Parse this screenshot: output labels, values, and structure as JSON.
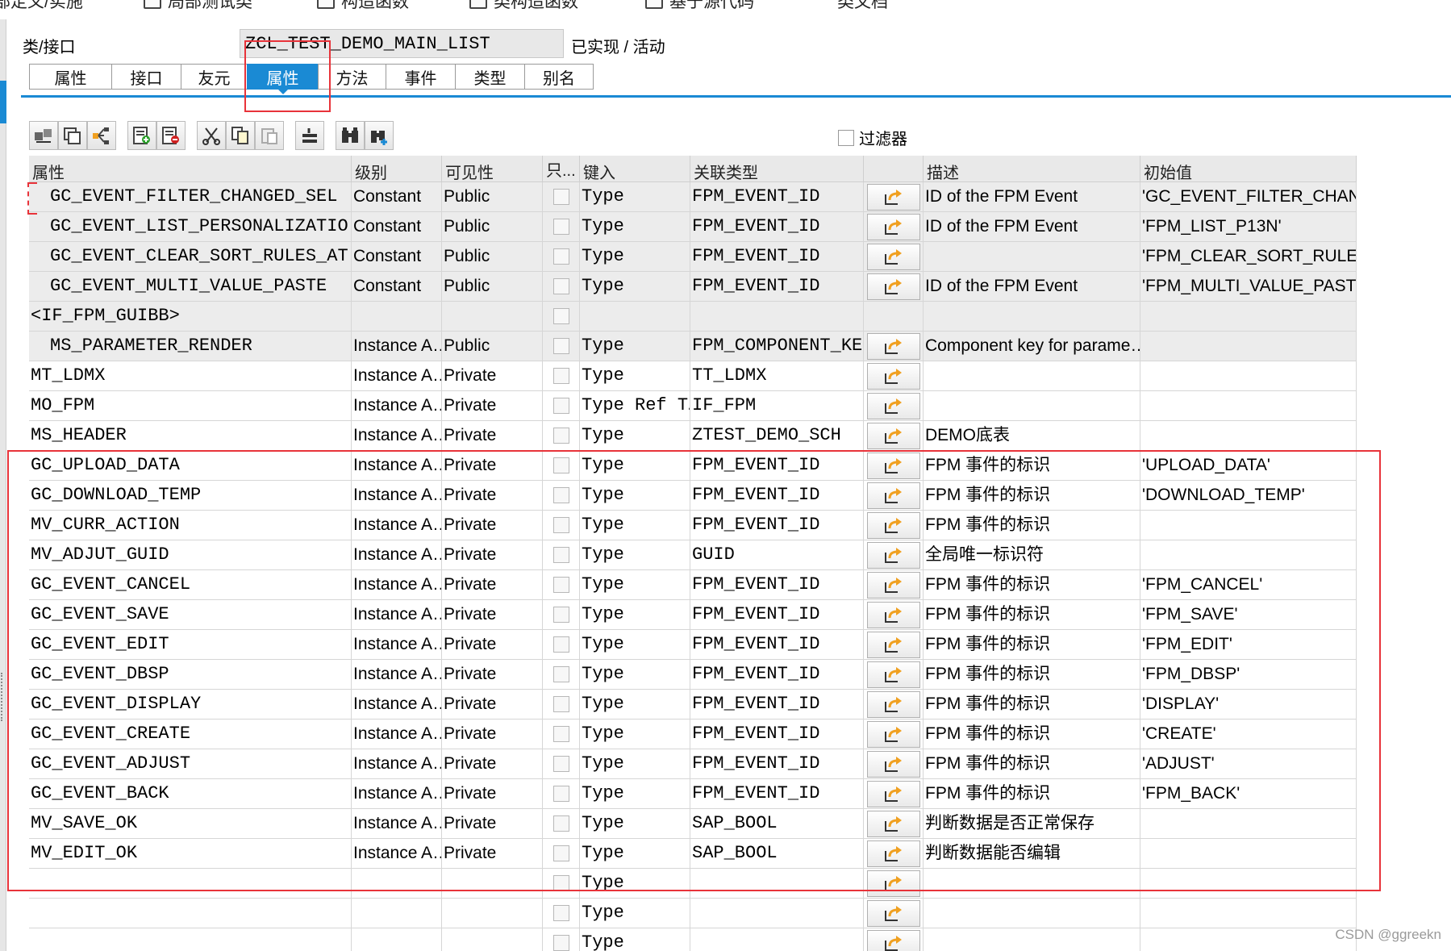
{
  "top_menu": [
    {
      "label": "部定义/实施",
      "x_icon": false
    },
    {
      "label": "局部测试类",
      "x_icon": true
    },
    {
      "label": "构造函数",
      "x_icon": true
    },
    {
      "label": "类构造函数",
      "x_icon": true
    },
    {
      "label": "基于源代码",
      "x_icon": true
    },
    {
      "label": "类文档",
      "x_icon": false
    }
  ],
  "header": {
    "class_label": "类/接口",
    "class_name": "ZCL_TEST_DEMO_MAIN_LIST",
    "status": "已实现 / 活动"
  },
  "tabs": [
    {
      "label": "属性",
      "active": false
    },
    {
      "label": "接口",
      "active": false
    },
    {
      "label": "友元",
      "active": false
    },
    {
      "label": "属性",
      "active": true
    },
    {
      "label": "方法",
      "active": false
    },
    {
      "label": "事件",
      "active": false
    },
    {
      "label": "类型",
      "active": false
    },
    {
      "label": "别名",
      "active": false
    }
  ],
  "toolbar": {
    "filter_label": "过滤器",
    "buttons": [
      "local-types-icon",
      "navigate-icon",
      "hierarchy-icon",
      "insert-row-icon",
      "delete-row-icon",
      "cut-icon",
      "copy-icon",
      "paste-icon",
      "detail-icon",
      "find-icon",
      "find-next-icon"
    ]
  },
  "table": {
    "columns": [
      "属性",
      "级别",
      "可见性",
      "只...",
      "键入",
      "关联类型",
      "",
      "描述",
      "初始值"
    ],
    "rows": [
      {
        "attr": "GC_EVENT_FILTER_CHANGED_SEL",
        "indent": true,
        "grey": true,
        "level": "Constant",
        "vis": "Public",
        "key": "Type",
        "type": "FPM_EVENT_ID",
        "desc": "ID of the FPM Event",
        "init": "'GC_EVENT_FILTER_CHANG…"
      },
      {
        "attr": "GC_EVENT_LIST_PERSONALIZATIO",
        "indent": true,
        "grey": true,
        "level": "Constant",
        "vis": "Public",
        "key": "Type",
        "type": "FPM_EVENT_ID",
        "desc": "ID of the FPM Event",
        "init": "'FPM_LIST_P13N'"
      },
      {
        "attr": "GC_EVENT_CLEAR_SORT_RULES_AT",
        "indent": true,
        "grey": true,
        "level": "Constant",
        "vis": "Public",
        "key": "Type",
        "type": "FPM_EVENT_ID",
        "desc": "",
        "init": "'FPM_CLEAR_SORT_RULES_…"
      },
      {
        "attr": "GC_EVENT_MULTI_VALUE_PASTE",
        "indent": true,
        "grey": true,
        "level": "Constant",
        "vis": "Public",
        "key": "Type",
        "type": "FPM_EVENT_ID",
        "desc": "ID of the FPM Event",
        "init": "'FPM_MULTI_VALUE_PASTE'"
      },
      {
        "attr": "<IF_FPM_GUIBB>",
        "indent": false,
        "grey": true,
        "group": true,
        "level": "",
        "vis": "",
        "key": "",
        "type": "",
        "desc": "",
        "init": ""
      },
      {
        "attr": "MS_PARAMETER_RENDER",
        "indent": true,
        "grey": true,
        "level": "Instance A…",
        "vis": "Public",
        "key": "Type",
        "type": "FPM_COMPONENT_KE…",
        "desc": "Component key for parame…",
        "init": ""
      },
      {
        "attr": "MT_LDMX",
        "indent": false,
        "grey": false,
        "level": "Instance A…",
        "vis": "Private",
        "key": "Type",
        "type": "TT_LDMX",
        "desc": "",
        "init": ""
      },
      {
        "attr": "MO_FPM",
        "indent": false,
        "grey": false,
        "level": "Instance A…",
        "vis": "Private",
        "key": "Type Ref T…",
        "type": "IF_FPM",
        "desc": "",
        "init": ""
      },
      {
        "attr": "MS_HEADER",
        "indent": false,
        "grey": false,
        "level": "Instance A…",
        "vis": "Private",
        "key": "Type",
        "type": "ZTEST_DEMO_SCH",
        "desc": "DEMO底表",
        "init": ""
      },
      {
        "attr": "GC_UPLOAD_DATA",
        "indent": false,
        "grey": false,
        "level": "Instance A…",
        "vis": "Private",
        "key": "Type",
        "type": "FPM_EVENT_ID",
        "desc": "FPM 事件的标识",
        "init": "'UPLOAD_DATA'"
      },
      {
        "attr": "GC_DOWNLOAD_TEMP",
        "indent": false,
        "grey": false,
        "level": "Instance A…",
        "vis": "Private",
        "key": "Type",
        "type": "FPM_EVENT_ID",
        "desc": "FPM 事件的标识",
        "init": "'DOWNLOAD_TEMP'"
      },
      {
        "attr": "MV_CURR_ACTION",
        "indent": false,
        "grey": false,
        "level": "Instance A…",
        "vis": "Private",
        "key": "Type",
        "type": "FPM_EVENT_ID",
        "desc": "FPM 事件的标识",
        "init": ""
      },
      {
        "attr": "MV_ADJUT_GUID",
        "indent": false,
        "grey": false,
        "level": "Instance A…",
        "vis": "Private",
        "key": "Type",
        "type": "GUID",
        "desc": "全局唯一标识符",
        "init": ""
      },
      {
        "attr": "GC_EVENT_CANCEL",
        "indent": false,
        "grey": false,
        "level": "Instance A…",
        "vis": "Private",
        "key": "Type",
        "type": "FPM_EVENT_ID",
        "desc": "FPM 事件的标识",
        "init": "'FPM_CANCEL'"
      },
      {
        "attr": "GC_EVENT_SAVE",
        "indent": false,
        "grey": false,
        "level": "Instance A…",
        "vis": "Private",
        "key": "Type",
        "type": "FPM_EVENT_ID",
        "desc": "FPM 事件的标识",
        "init": "'FPM_SAVE'"
      },
      {
        "attr": "GC_EVENT_EDIT",
        "indent": false,
        "grey": false,
        "level": "Instance A…",
        "vis": "Private",
        "key": "Type",
        "type": "FPM_EVENT_ID",
        "desc": "FPM 事件的标识",
        "init": "'FPM_EDIT'"
      },
      {
        "attr": "GC_EVENT_DBSP",
        "indent": false,
        "grey": false,
        "level": "Instance A…",
        "vis": "Private",
        "key": "Type",
        "type": "FPM_EVENT_ID",
        "desc": "FPM 事件的标识",
        "init": "'FPM_DBSP'"
      },
      {
        "attr": "GC_EVENT_DISPLAY",
        "indent": false,
        "grey": false,
        "level": "Instance A…",
        "vis": "Private",
        "key": "Type",
        "type": "FPM_EVENT_ID",
        "desc": "FPM 事件的标识",
        "init": "'DISPLAY'"
      },
      {
        "attr": "GC_EVENT_CREATE",
        "indent": false,
        "grey": false,
        "level": "Instance A…",
        "vis": "Private",
        "key": "Type",
        "type": "FPM_EVENT_ID",
        "desc": "FPM 事件的标识",
        "init": "'CREATE'"
      },
      {
        "attr": "GC_EVENT_ADJUST",
        "indent": false,
        "grey": false,
        "level": "Instance A…",
        "vis": "Private",
        "key": "Type",
        "type": "FPM_EVENT_ID",
        "desc": "FPM 事件的标识",
        "init": "'ADJUST'"
      },
      {
        "attr": "GC_EVENT_BACK",
        "indent": false,
        "grey": false,
        "level": "Instance A…",
        "vis": "Private",
        "key": "Type",
        "type": "FPM_EVENT_ID",
        "desc": "FPM 事件的标识",
        "init": "'FPM_BACK'"
      },
      {
        "attr": "MV_SAVE_OK",
        "indent": false,
        "grey": false,
        "level": "Instance A…",
        "vis": "Private",
        "key": "Type",
        "type": "SAP_BOOL",
        "desc": "判断数据是否正常保存",
        "init": ""
      },
      {
        "attr": "MV_EDIT_OK",
        "indent": false,
        "grey": false,
        "level": "Instance A…",
        "vis": "Private",
        "key": "Type",
        "type": "SAP_BOOL",
        "desc": "判断数据能否编辑",
        "init": ""
      },
      {
        "attr": "",
        "indent": false,
        "grey": false,
        "level": "",
        "vis": "",
        "key": "Type",
        "type": "",
        "desc": "",
        "init": ""
      },
      {
        "attr": "",
        "indent": false,
        "grey": false,
        "level": "",
        "vis": "",
        "key": "Type",
        "type": "",
        "desc": "",
        "init": ""
      },
      {
        "attr": "",
        "indent": false,
        "grey": false,
        "level": "",
        "vis": "",
        "key": "Type",
        "type": "",
        "desc": "",
        "init": ""
      }
    ]
  },
  "watermark": "CSDN @ggreekn",
  "colors": {
    "accent": "#1a8ad4",
    "highlight": "#e8333a",
    "header_grey": "#e9e9e9",
    "row_grey": "#ececec"
  }
}
